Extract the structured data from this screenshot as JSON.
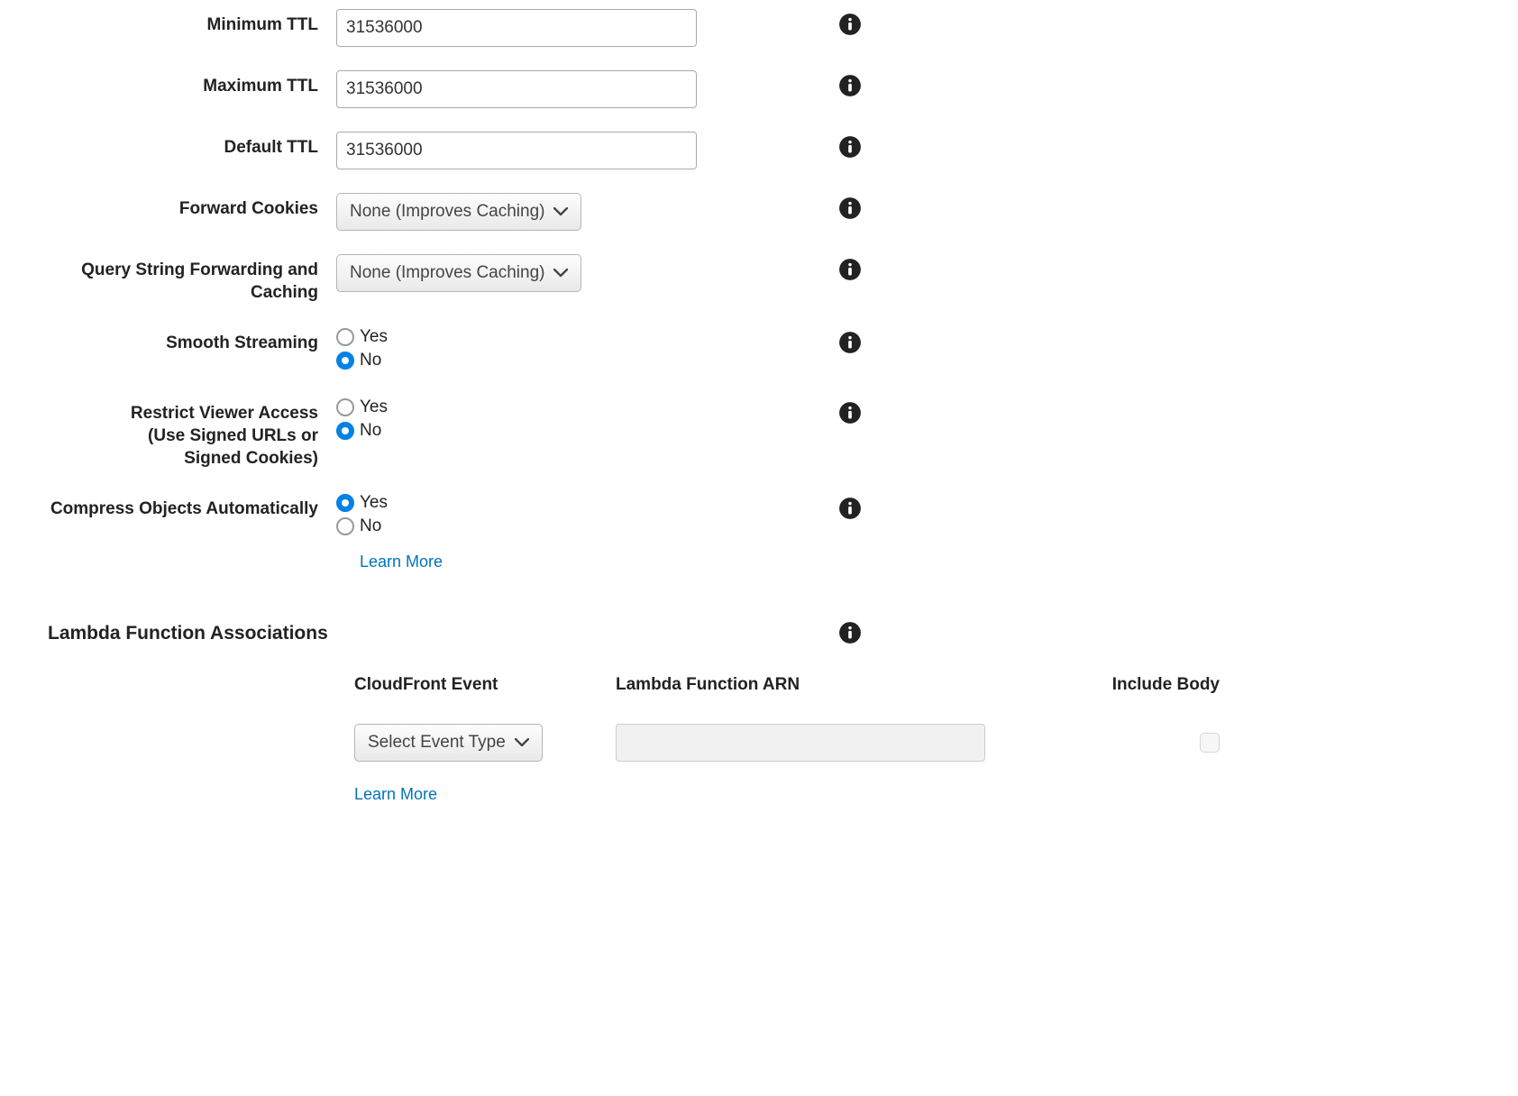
{
  "fields": {
    "minimum_ttl": {
      "label": "Minimum TTL",
      "value": "31536000"
    },
    "maximum_ttl": {
      "label": "Maximum TTL",
      "value": "31536000"
    },
    "default_ttl": {
      "label": "Default TTL",
      "value": "31536000"
    },
    "forward_cookies": {
      "label": "Forward Cookies",
      "value": "None (Improves Caching)"
    },
    "query_string": {
      "label": "Query String Forwarding and Caching",
      "value": "None (Improves Caching)"
    },
    "smooth_streaming": {
      "label": "Smooth Streaming",
      "yes": "Yes",
      "no": "No"
    },
    "restrict_viewer": {
      "label": "Restrict Viewer Access\n(Use Signed URLs or\nSigned Cookies)",
      "yes": "Yes",
      "no": "No"
    },
    "compress": {
      "label": "Compress Objects Automatically",
      "yes": "Yes",
      "no": "No",
      "learn_more": "Learn More"
    }
  },
  "lambda": {
    "title": "Lambda Function Associations",
    "col_event": "CloudFront Event",
    "col_arn": "Lambda Function ARN",
    "col_include": "Include Body",
    "select_placeholder": "Select Event Type",
    "learn_more": "Learn More"
  }
}
